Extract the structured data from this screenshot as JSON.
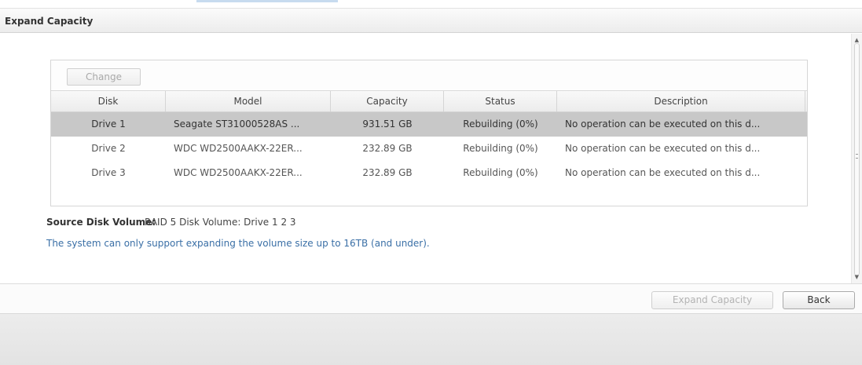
{
  "window": {
    "title": "Expand Capacity"
  },
  "toolbar": {
    "change_label": "Change"
  },
  "grid": {
    "columns": [
      "Disk",
      "Model",
      "Capacity",
      "Status",
      "Description"
    ],
    "rows": [
      {
        "disk": "Drive 1",
        "model": "Seagate ST31000528AS ...",
        "capacity": "931.51 GB",
        "status": "Rebuilding  (0%)",
        "description": "No operation can be executed on this d..."
      },
      {
        "disk": "Drive 2",
        "model": "WDC WD2500AAKX-22ER...",
        "capacity": "232.89 GB",
        "status": "Rebuilding  (0%)",
        "description": "No operation can be executed on this d..."
      },
      {
        "disk": "Drive 3",
        "model": "WDC WD2500AAKX-22ER...",
        "capacity": "232.89 GB",
        "status": "Rebuilding  (0%)",
        "description": "No operation can be executed on this d..."
      }
    ],
    "selected_row": 0
  },
  "source": {
    "label": "Source Disk Volume:",
    "value": "RAID 5 Disk Volume: Drive 1 2 3"
  },
  "note": "The system can only support expanding the volume size up to 16TB (and under).",
  "footer": {
    "expand_label": "Expand Capacity",
    "back_label": "Back"
  },
  "icons": {
    "scroll_up": "scroll-up-arrow-icon",
    "scroll_down": "scroll-down-arrow-icon"
  },
  "colors": {
    "selected_row": "#c8c8c8",
    "note_text": "#3a6fa6"
  }
}
